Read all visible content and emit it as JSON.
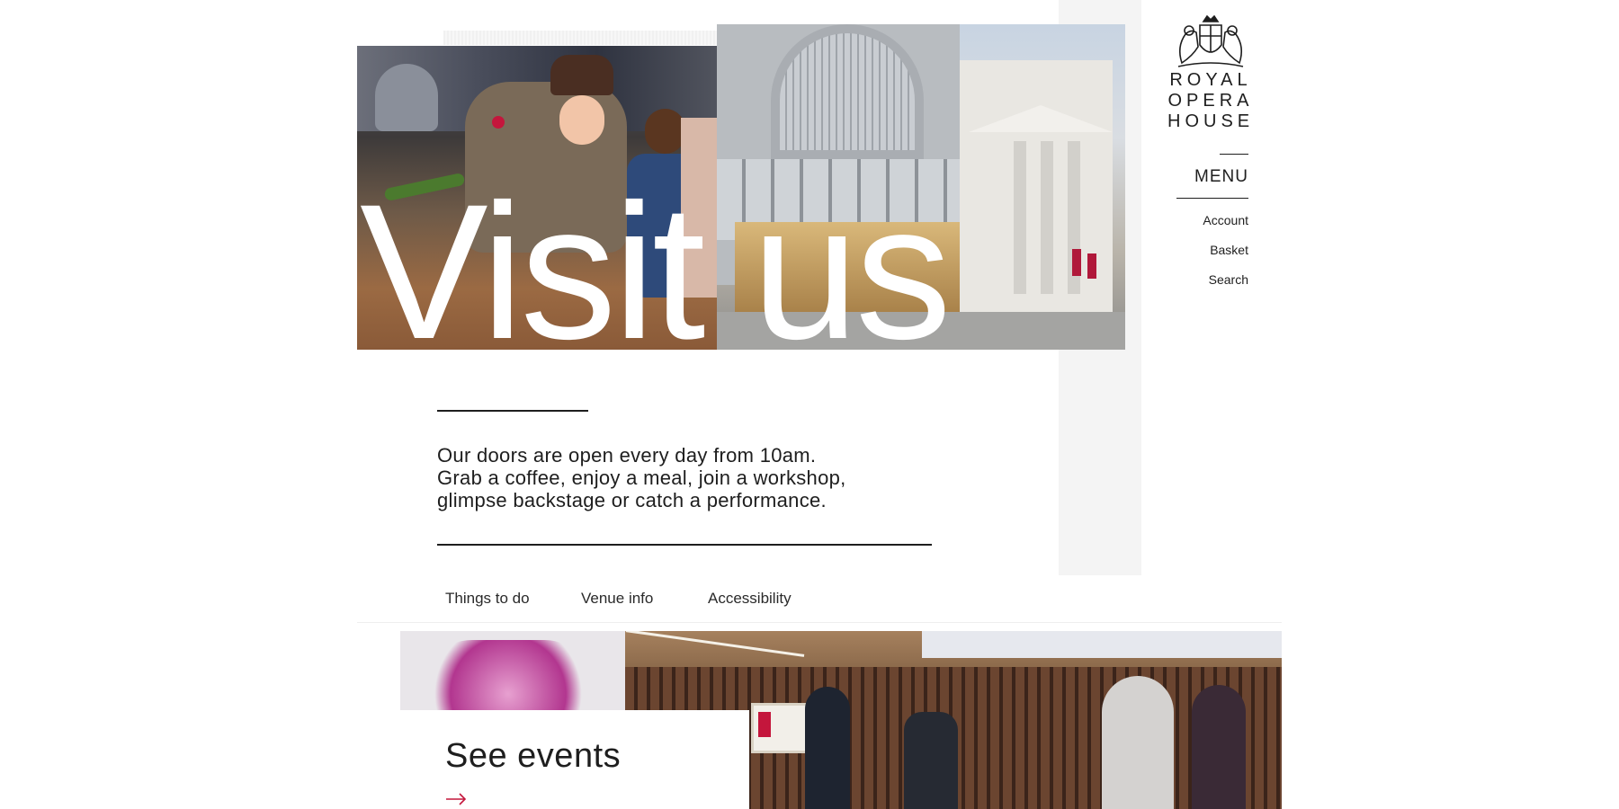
{
  "brand": {
    "lines": [
      "ROYAL",
      "OPERA",
      "HOUSE"
    ]
  },
  "nav": {
    "menu_label": "MENU",
    "utility_links": [
      "Account",
      "Basket",
      "Search"
    ]
  },
  "hero": {
    "title": "Visit us",
    "left_image": "people-with-roses-photo",
    "right_image": "opera-house-exterior-photo"
  },
  "intro": {
    "lines": [
      "Our doors are open every day from 10am.",
      "Grab a coffee, enjoy a meal, join a workshop,",
      "glimpse backstage or catch a performance."
    ]
  },
  "tabs": [
    "Things to do",
    "Venue info",
    "Accessibility"
  ],
  "events": {
    "title": "See events",
    "arrow_icon": "arrow-right-icon",
    "image": "musicians-performing-photo"
  },
  "colors": {
    "text": "#1e1e1e",
    "accent": "#c4163c",
    "panel": "#f4f4f4"
  }
}
